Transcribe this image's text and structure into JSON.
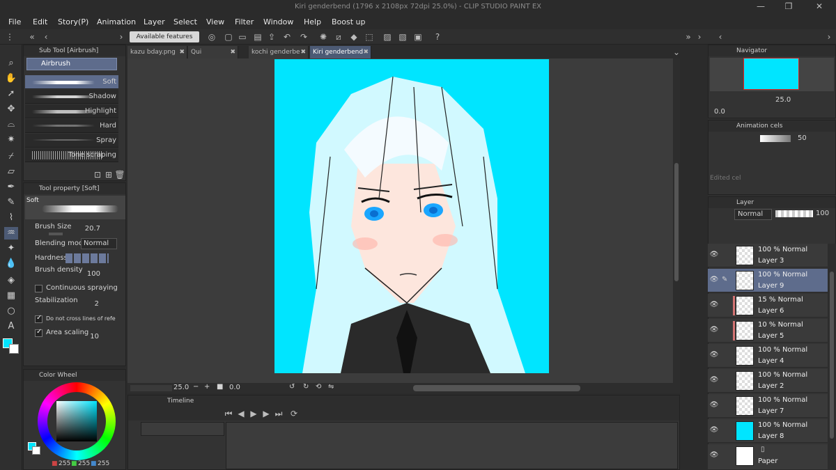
{
  "window": {
    "title": "Kiri genderbend (1796 x 2108px 72dpi 25.0%) - CLIP STUDIO PAINT EX"
  },
  "menu": [
    "File",
    "Edit",
    "Story(P)",
    "Animation",
    "Layer",
    "Select",
    "View",
    "Filter",
    "Window",
    "Help",
    "Boost up"
  ],
  "command_bar": {
    "available_features": "Available features"
  },
  "subtool": {
    "panel_title": "Sub Tool [Airbrush]",
    "group": "Airbrush",
    "brushes": [
      "Soft",
      "Shadow",
      "Highlight",
      "Hard",
      "Spray",
      "Tone scraping"
    ]
  },
  "tool_property": {
    "panel_title": "Tool property [Soft]",
    "preview_name": "Soft",
    "brush_size_label": "Brush Size",
    "brush_size_value": "20.7",
    "blending_mode_label": "Blending mode",
    "blending_mode_value": "Normal",
    "hardness_label": "Hardness",
    "brush_density_label": "Brush density",
    "brush_density_value": "100",
    "continuous_spraying_label": "Continuous spraying",
    "stabilization_label": "Stabilization",
    "stabilization_value": "2",
    "do_not_cross_label": "Do not cross lines of reference l",
    "area_scaling_label": "Area scaling",
    "area_scaling_value": "10"
  },
  "color_wheel": {
    "panel_title": "Color Wheel",
    "r": "255",
    "g": "255",
    "b": "255",
    "main_color": "#00e5ff"
  },
  "tabs": [
    {
      "label": "kazu bday.png"
    },
    {
      "label": "Qui Genderbend"
    },
    {
      "label": "kochi genderbe"
    },
    {
      "label": "Kiri genderbend"
    }
  ],
  "canvas_nav": {
    "zoom": "25.0",
    "rotation": "0.0"
  },
  "timeline": {
    "panel_title": "Timeline"
  },
  "navigator": {
    "panel_title": "Navigator",
    "zoom": "25.0",
    "rotation": "0.0"
  },
  "animation_cels": {
    "panel_title": "Animation cels",
    "opacity": "50",
    "edited_cel": "Edited cel"
  },
  "layer_panel": {
    "panel_title": "Layer",
    "blend_mode": "Normal",
    "opacity": "100",
    "layers": [
      {
        "mode": "100 % Normal",
        "name": "Layer 3"
      },
      {
        "mode": "100 % Normal",
        "name": "Layer 9"
      },
      {
        "mode": "15 % Normal",
        "name": "Layer 6"
      },
      {
        "mode": "10 % Normal",
        "name": "Layer 5"
      },
      {
        "mode": "100 % Normal",
        "name": "Layer 4"
      },
      {
        "mode": "100 % Normal",
        "name": "Layer 2"
      },
      {
        "mode": "100 % Normal",
        "name": "Layer 7"
      },
      {
        "mode": "100 % Normal",
        "name": "Layer 8"
      },
      {
        "mode": "",
        "name": "Paper"
      }
    ]
  },
  "colors": {
    "accent": "#4c5a74",
    "canvas_bg": "#00e5ff",
    "selected_layer": "#5e6c8c"
  }
}
